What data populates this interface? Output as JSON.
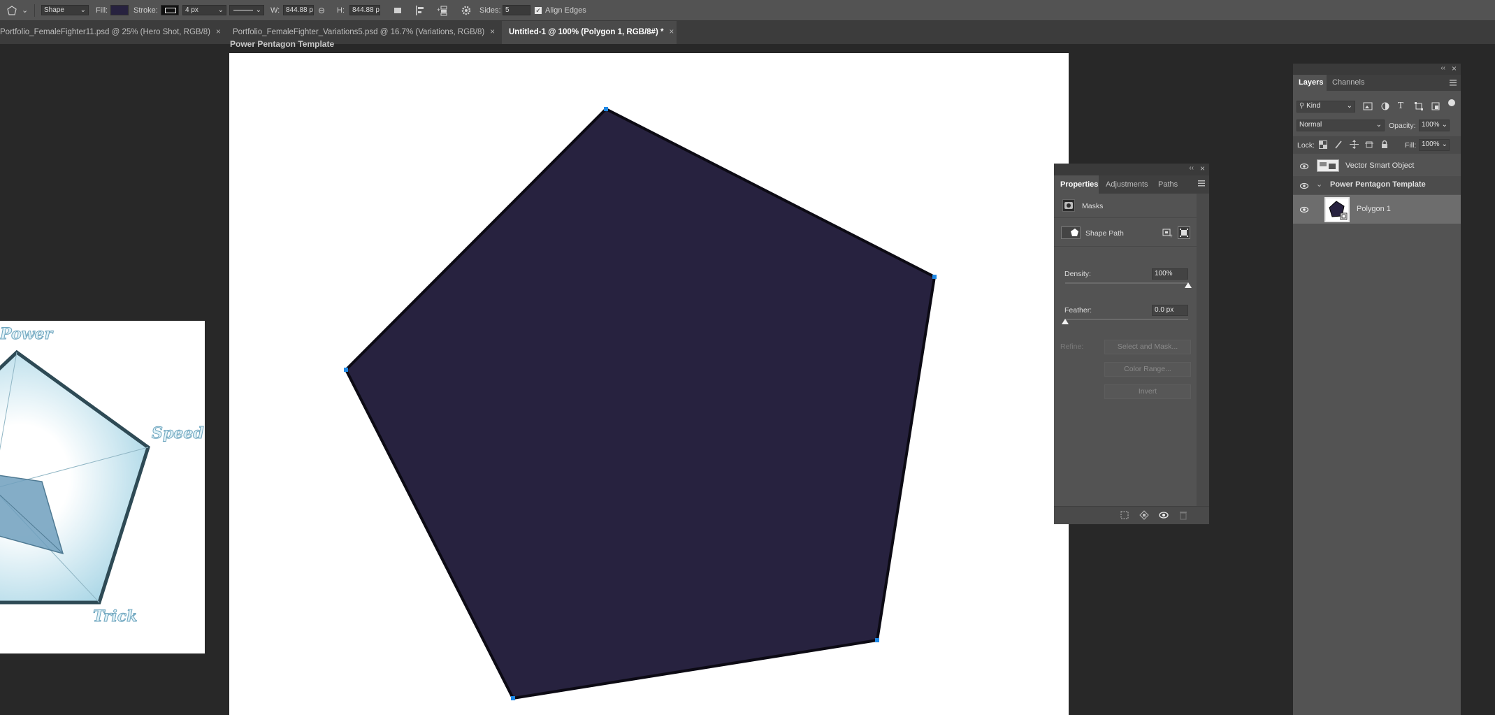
{
  "options_bar": {
    "tool_mode": "Shape",
    "fill_label": "Fill:",
    "fill_color": "#27223f",
    "stroke_label": "Stroke:",
    "stroke_width": "4 px",
    "width_label": "W:",
    "width_value": "844.88 p",
    "height_label": "H:",
    "height_value": "844.88 p",
    "sides_label": "Sides:",
    "sides_value": "5",
    "align_edges_label": "Align Edges",
    "align_edges_checked": true
  },
  "tabs": [
    {
      "label": "Portfolio_FemaleFighter11.psd @ 25% (Hero Shot, RGB/8)",
      "active": false
    },
    {
      "label": "Portfolio_FemaleFighter_Variations5.psd @ 16.7% (Variations, RGB/8)",
      "active": false
    },
    {
      "label": "Untitled-1 @ 100% (Polygon 1, RGB/8#) *",
      "active": true
    }
  ],
  "close_glyph": "×",
  "document": {
    "title": "Power Pentagon Template",
    "shape_fill": "#27223f",
    "shape_stroke": "#0c0a14"
  },
  "reference_image": {
    "labels": [
      "Power",
      "Speed",
      "Trick"
    ]
  },
  "properties_panel": {
    "tabs": [
      "Properties",
      "Adjustments",
      "Paths"
    ],
    "masks_label": "Masks",
    "shape_path_label": "Shape Path",
    "density_label": "Density:",
    "density_value": "100%",
    "density_level": 1.0,
    "feather_label": "Feather:",
    "feather_value": "0.0 px",
    "feather_level": 0.0,
    "refine_label": "Refine:",
    "buttons": [
      "Select and Mask...",
      "Color Range...",
      "Invert"
    ]
  },
  "layers_panel": {
    "tabs": [
      "Layers",
      "Channels"
    ],
    "filter_kind": "Kind",
    "blend_mode": "Normal",
    "opacity_label": "Opacity:",
    "opacity_value": "100%",
    "lock_label": "Lock:",
    "fill_label": "Fill:",
    "fill_value": "100%",
    "layers": [
      {
        "name": "Vector Smart Object",
        "visible": true,
        "group": false,
        "selected": false
      },
      {
        "name": "Power Pentagon Template",
        "visible": true,
        "group": true,
        "selected": false
      },
      {
        "name": "Polygon 1",
        "visible": true,
        "group": false,
        "selected": true
      }
    ]
  },
  "colors": {
    "app_bg": "#282828",
    "panel_bg": "#535353",
    "accent_handle": "#1e88e5"
  }
}
